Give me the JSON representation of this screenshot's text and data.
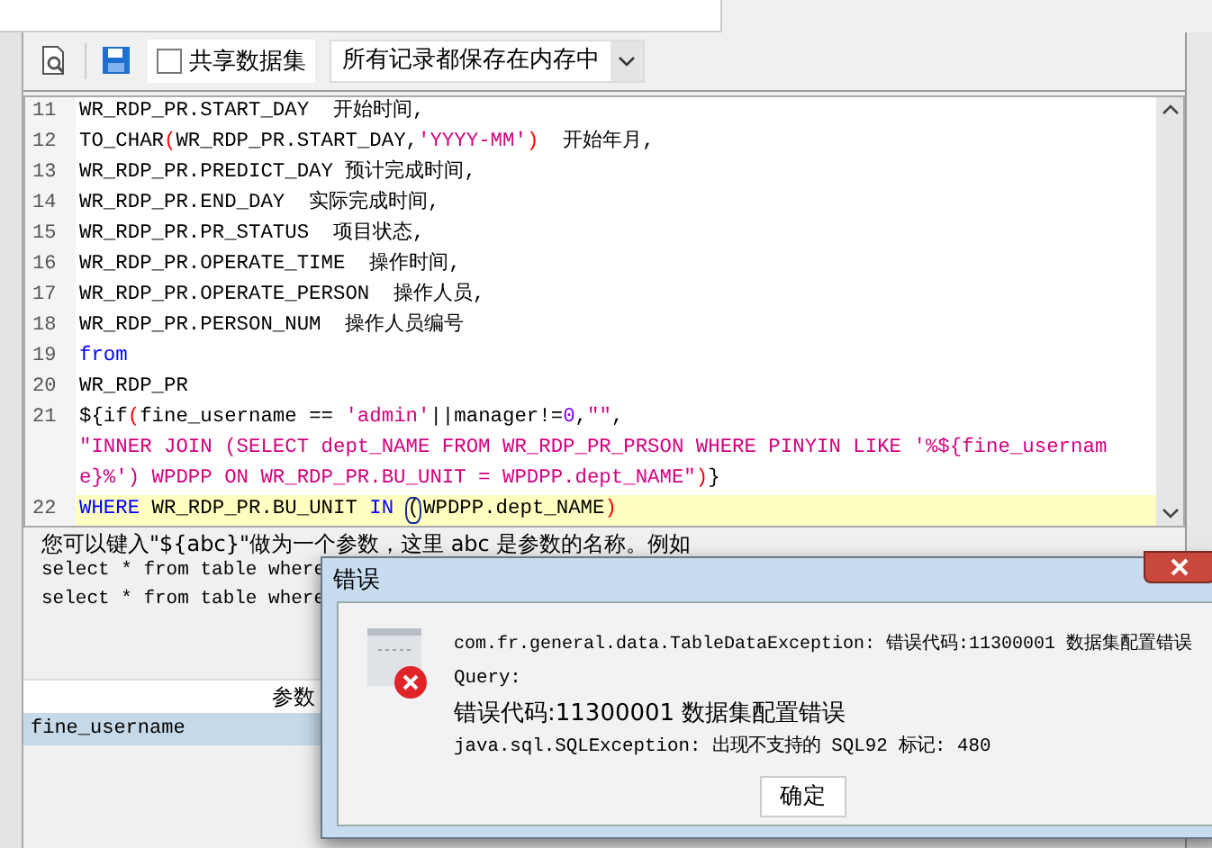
{
  "toolbar": {
    "shared_checkbox": {
      "label": "共享数据集",
      "checked": false
    },
    "storage_dropdown": {
      "value": "所有记录都保存在内存中"
    }
  },
  "editor": {
    "rows": [
      {
        "number": "11",
        "highlighted": false,
        "segments": [
          {
            "kind": "plain",
            "text": "WR_RDP_PR.START_DAY  开始时间,"
          }
        ]
      },
      {
        "number": "12",
        "highlighted": false,
        "segments": [
          {
            "kind": "plain",
            "text": "TO_CHAR"
          },
          {
            "kind": "paren",
            "text": "("
          },
          {
            "kind": "plain",
            "text": "WR_RDP_PR.START_DAY,"
          },
          {
            "kind": "string",
            "text": "'YYYY-MM'"
          },
          {
            "kind": "paren",
            "text": ")"
          },
          {
            "kind": "plain",
            "text": "  开始年月,"
          }
        ]
      },
      {
        "number": "13",
        "highlighted": false,
        "segments": [
          {
            "kind": "plain",
            "text": "WR_RDP_PR.PREDICT_DAY 预计完成时间,"
          }
        ]
      },
      {
        "number": "14",
        "highlighted": false,
        "segments": [
          {
            "kind": "plain",
            "text": "WR_RDP_PR.END_DAY  实际完成时间,"
          }
        ]
      },
      {
        "number": "15",
        "highlighted": false,
        "segments": [
          {
            "kind": "plain",
            "text": "WR_RDP_PR.PR_STATUS  项目状态,"
          }
        ]
      },
      {
        "number": "16",
        "highlighted": false,
        "segments": [
          {
            "kind": "plain",
            "text": "WR_RDP_PR.OPERATE_TIME  操作时间,"
          }
        ]
      },
      {
        "number": "17",
        "highlighted": false,
        "segments": [
          {
            "kind": "plain",
            "text": "WR_RDP_PR.OPERATE_PERSON  操作人员,"
          }
        ]
      },
      {
        "number": "18",
        "highlighted": false,
        "segments": [
          {
            "kind": "plain",
            "text": "WR_RDP_PR.PERSON_NUM  操作人员编号"
          }
        ]
      },
      {
        "number": "19",
        "highlighted": false,
        "segments": [
          {
            "kind": "keyword",
            "text": "from"
          }
        ]
      },
      {
        "number": "20",
        "highlighted": false,
        "segments": [
          {
            "kind": "plain",
            "text": "WR_RDP_PR"
          }
        ]
      },
      {
        "number": "21",
        "highlighted": false,
        "segments": [
          {
            "kind": "plain",
            "text": "${if"
          },
          {
            "kind": "paren",
            "text": "("
          },
          {
            "kind": "plain",
            "text": "fine_username == "
          },
          {
            "kind": "string",
            "text": "'admin'"
          },
          {
            "kind": "plain",
            "text": "||manager!="
          },
          {
            "kind": "number",
            "text": "0"
          },
          {
            "kind": "plain",
            "text": ","
          },
          {
            "kind": "string",
            "text": "\"\""
          },
          {
            "kind": "plain",
            "text": ","
          }
        ]
      },
      {
        "highlighted": false,
        "segments": [
          {
            "kind": "string",
            "text": "\"INNER JOIN (SELECT dept_NAME FROM WR_RDP_PR_PRSON WHERE PINYIN LIKE '%${fine_usernam"
          }
        ]
      },
      {
        "highlighted": false,
        "segments": [
          {
            "kind": "string",
            "text": "e}%') WPDPP ON WR_RDP_PR.BU_UNIT = WPDPP.dept_NAME\""
          },
          {
            "kind": "paren",
            "text": ")"
          },
          {
            "kind": "plain",
            "text": "}"
          }
        ]
      },
      {
        "number": "22",
        "highlighted": true,
        "segments": [
          {
            "kind": "keyword",
            "text": "WHERE"
          },
          {
            "kind": "plain",
            "text": " WR_RDP_PR.BU_UNIT "
          },
          {
            "kind": "keyword",
            "text": "IN "
          },
          {
            "kind": "match",
            "text": "("
          },
          {
            "kind": "plain",
            "text": "WPDPP.dept_NAME"
          },
          {
            "kind": "paren",
            "text": ")"
          }
        ]
      }
    ]
  },
  "hint": {
    "text": "您可以键入\"${abc}\"做为一个参数，这里 abc 是参数的名称。例如",
    "examples": [
      "select * from table where",
      "select * from table where"
    ]
  },
  "params_table": {
    "header": "参数",
    "rows": [
      {
        "name": "fine_username",
        "selected": true
      }
    ]
  },
  "dialog": {
    "title": "错误",
    "lines": [
      "com.fr.general.data.TableDataException: 错误代码:11300001 数据集配置错误",
      "Query:",
      "错误代码:11300001 数据集配置错误",
      "java.sql.SQLException: 出现不支持的 SQL92 标记: 480"
    ],
    "ok_button": "确定"
  }
}
